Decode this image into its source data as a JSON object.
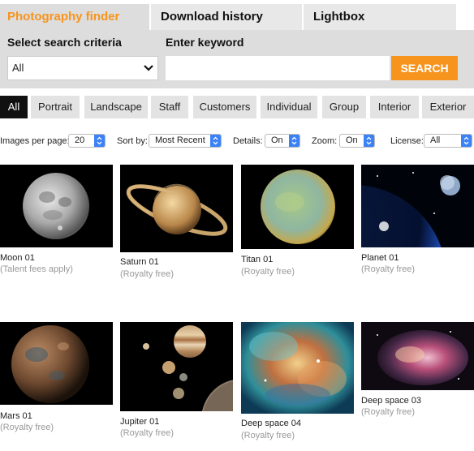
{
  "tabs": {
    "finder": "Photography finder",
    "history": "Download history",
    "lightbox": "Lightbox"
  },
  "search": {
    "criteria_label": "Select search criteria",
    "keyword_label": "Enter keyword",
    "criteria_value": "All",
    "keyword_value": "",
    "button_label": "SEARCH"
  },
  "categories": [
    "All",
    "Portrait",
    "Landscape",
    "Staff",
    "Customers",
    "Individual",
    "Group",
    "Interior",
    "Exterior"
  ],
  "options": {
    "per_page_label": "Images per page:",
    "per_page_value": "20",
    "sort_label": "Sort by:",
    "sort_value": "Most Recent",
    "details_label": "Details:",
    "details_value": "On",
    "zoom_label": "Zoom:",
    "zoom_value": "On",
    "license_label": "License:",
    "license_value": "All"
  },
  "images": [
    {
      "title": "Moon 01",
      "license": "(Talent fees apply)"
    },
    {
      "title": "Saturn 01",
      "license": "(Royalty free)"
    },
    {
      "title": "Titan 01",
      "license": "(Royalty free)"
    },
    {
      "title": "Planet 01",
      "license": "(Royalty free)"
    },
    {
      "title": "Mars 01",
      "license": "(Royalty free)"
    },
    {
      "title": "Jupiter 01",
      "license": "(Royalty free)"
    },
    {
      "title": "Deep space 04",
      "license": "(Royalty free)"
    },
    {
      "title": "Deep space 03",
      "license": "(Royalty free)"
    }
  ],
  "colors": {
    "accent": "#f7941d",
    "panel": "#dddddd",
    "pill": "#e3e3e3",
    "active_pill": "#111111",
    "select_arrow": "#3b82f6",
    "muted_text": "#999999"
  }
}
